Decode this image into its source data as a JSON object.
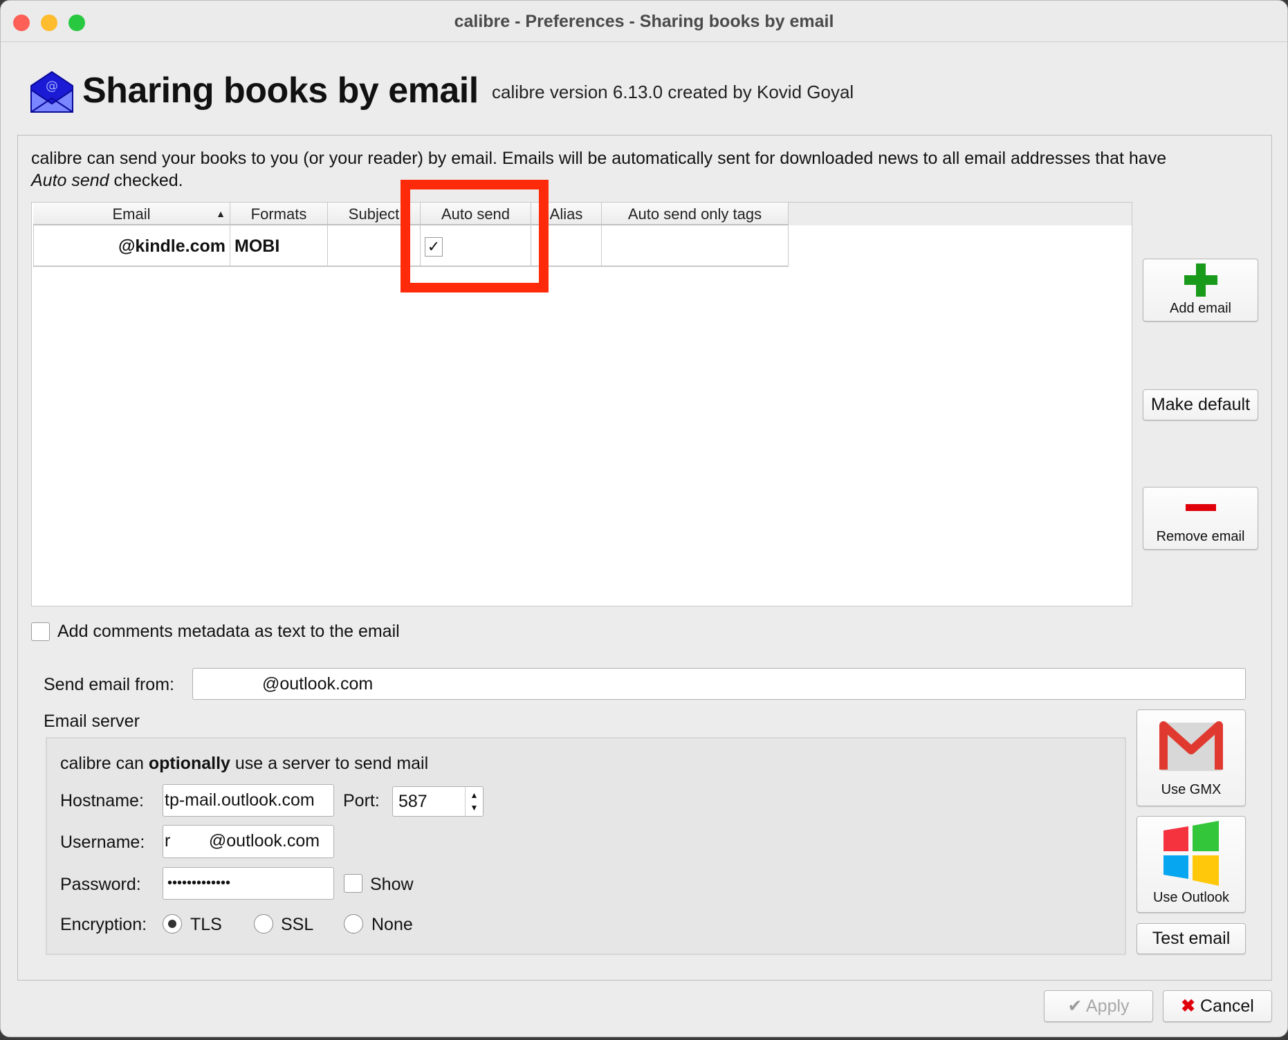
{
  "window": {
    "title": "calibre - Preferences - Sharing books by email"
  },
  "header": {
    "title": "Sharing books by email",
    "subtitle": "calibre version 6.13.0 created by Kovid Goyal",
    "icon": "email-envelope-icon"
  },
  "description": {
    "line1": "calibre can send your books to you (or your reader) by email. Emails will be automatically sent for downloaded news to all email addresses that have",
    "line2_italic": "Auto send",
    "line2_rest": " checked."
  },
  "table": {
    "columns": [
      "Email",
      "Formats",
      "Subject",
      "Auto send",
      "Alias",
      "Auto send only tags"
    ],
    "sort_column": "Email",
    "sort_direction": "ascending",
    "rows": [
      {
        "email": "@kindle.com",
        "formats": "MOBI",
        "subject": "",
        "auto_send": true,
        "alias": "",
        "tags": ""
      }
    ]
  },
  "side_buttons": {
    "add": "Add email",
    "make_default": "Make default",
    "remove": "Remove email"
  },
  "comments_checkbox": {
    "label": "Add comments metadata as text to the email",
    "checked": false
  },
  "send_from": {
    "label": "Send email from:",
    "value": "@outlook.com"
  },
  "server": {
    "section_label": "Email server",
    "intro_pre": "calibre can ",
    "intro_bold": "optionally",
    "intro_post": " use a server to send mail",
    "hostname_label": "Hostname:",
    "hostname": "tp-mail.outlook.com",
    "port_label": "Port:",
    "port": "587",
    "username_label": "Username:",
    "username": "r        @outlook.com",
    "password_label": "Password:",
    "password": "•••••••••••••",
    "show_label": "Show",
    "show_checked": false,
    "encryption_label": "Encryption:",
    "encryption_options": [
      "TLS",
      "SSL",
      "None"
    ],
    "encryption_selected": "TLS"
  },
  "provider_buttons": {
    "gmx": "Use GMX",
    "outlook": "Use Outlook",
    "test": "Test email"
  },
  "footer": {
    "apply": "Apply",
    "cancel": "Cancel"
  },
  "colors": {
    "highlight": "#ff2a0a",
    "add_green": "#1a9a1a",
    "remove_red": "#e0000a"
  }
}
